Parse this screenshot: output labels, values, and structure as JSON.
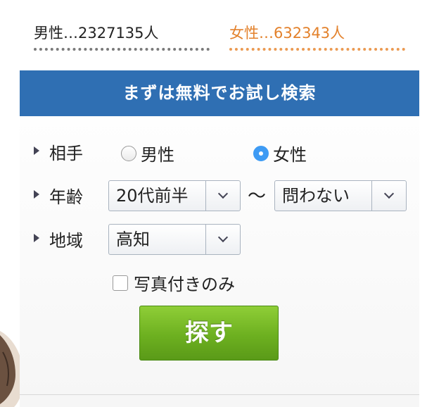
{
  "stats": {
    "male": "男性…2327135人",
    "female": "女性…632343人"
  },
  "banner": {
    "title": "まずは無料でお試し検索"
  },
  "form": {
    "partner": {
      "label": "相手",
      "options": [
        "男性",
        "女性"
      ],
      "selected": "女性"
    },
    "age": {
      "label": "年齢",
      "from": "20代前半",
      "separator": "〜",
      "to": "問わない"
    },
    "area": {
      "label": "地域",
      "value": "高知"
    },
    "photo_only": {
      "label": "写真付きのみ",
      "checked": false
    },
    "submit_label": "探す"
  },
  "colors": {
    "banner": "#2f6fb3",
    "female_text": "#e3812b",
    "button": "#6db020",
    "radio_checked": "#3e9bf4"
  }
}
